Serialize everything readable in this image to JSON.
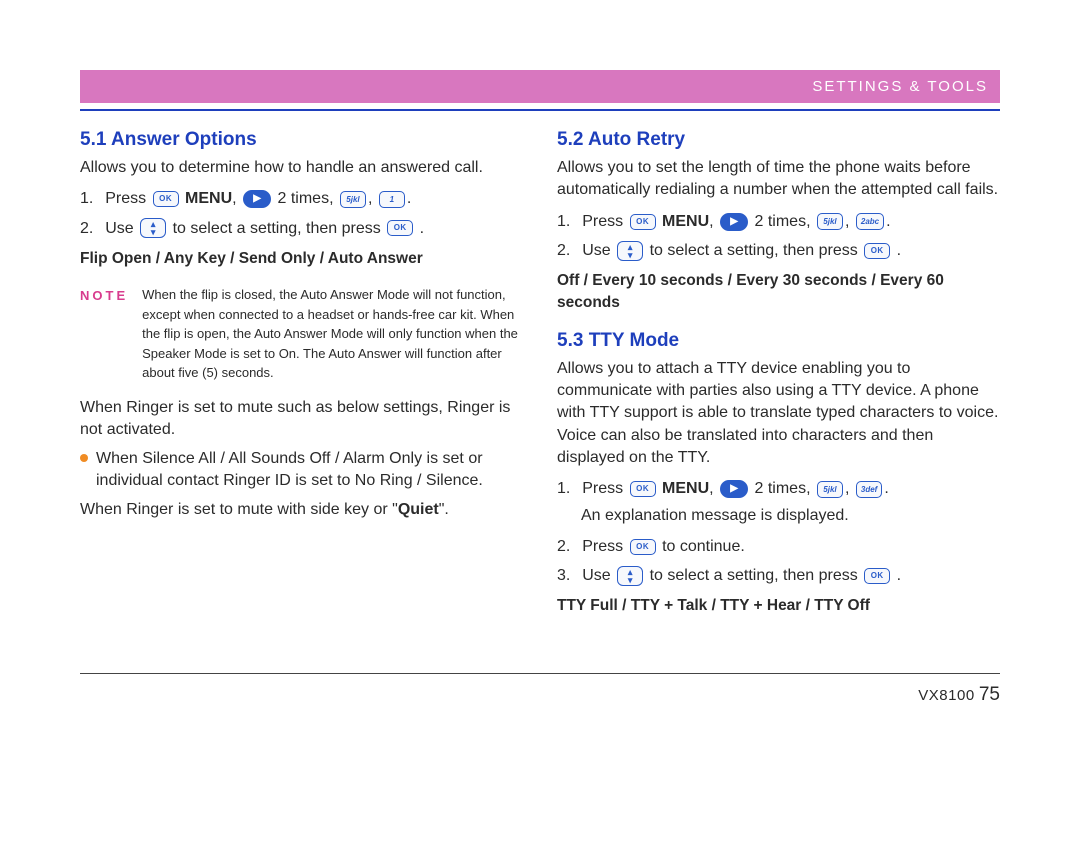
{
  "header": {
    "title": "SETTINGS & TOOLS"
  },
  "left": {
    "s51": {
      "title": "5.1 Answer Options",
      "intro": "Allows you to determine how to handle an answered call.",
      "step1_a": "1.",
      "step1_b": "Press ",
      "menu": "MENU",
      "two_times": "2 times,",
      "step2_a": "2.",
      "step2_b": "Use",
      "step2_c": "to select a setting, then press",
      "options": "Flip Open / Any Key / Send Only / Auto Answer",
      "note_label": "NOTE",
      "note_text": "When the flip is closed, the Auto Answer Mode will not function, except when connected to a headset or hands-free car kit. When the flip is open, the Auto Answer Mode will only function when the Speaker Mode is set to On. The Auto Answer will function after about five (5) seconds.",
      "para_ringer": "When Ringer is set to mute such as below settings, Ringer is not activated.",
      "bullet1": "When Silence All / All Sounds Off / Alarm Only is set or individual contact Ringer ID is set to No Ring / Silence.",
      "para_quiet_a": "When Ringer is set to mute with side key or \"",
      "para_quiet_b": "Quiet",
      "para_quiet_c": "\"."
    }
  },
  "right": {
    "s52": {
      "title": "5.2 Auto Retry",
      "intro": "Allows you to set the length of time the phone waits before automatically redialing a number when the attempted call fails.",
      "step1_a": "1.",
      "step1_b": "Press ",
      "menu": "MENU",
      "two_times": "2 times,",
      "step2_a": "2.",
      "step2_b": "Use",
      "step2_c": "to select a setting, then press",
      "options": "Off / Every 10 seconds / Every 30 seconds / Every 60 seconds"
    },
    "s53": {
      "title": "5.3 TTY Mode",
      "intro": "Allows you to attach a TTY device enabling you to communicate with parties also using a TTY device. A phone with TTY support is able to translate typed characters to voice. Voice can also be translated into characters and then displayed on the TTY.",
      "step1_a": "1.",
      "step1_b": "Press ",
      "menu": "MENU",
      "two_times": "2 times,",
      "step1_end": "An explanation message is displayed.",
      "step2_a": "2.",
      "step2_b": "Press",
      "step2_c": "to continue.",
      "step3_a": "3.",
      "step3_b": "Use",
      "step3_c": "to select a setting, then press",
      "options": "TTY Full / TTY + Talk / TTY + Hear / TTY Off"
    }
  },
  "keys": {
    "ok": "OK",
    "arrow": "▶",
    "five": "5",
    "five_sub": "jkl",
    "one": "1",
    "one_sub": " ",
    "two": "2",
    "two_sub": "abc",
    "three": "3",
    "three_sub": "def"
  },
  "footer": {
    "model": "VX8100",
    "page": "75"
  }
}
